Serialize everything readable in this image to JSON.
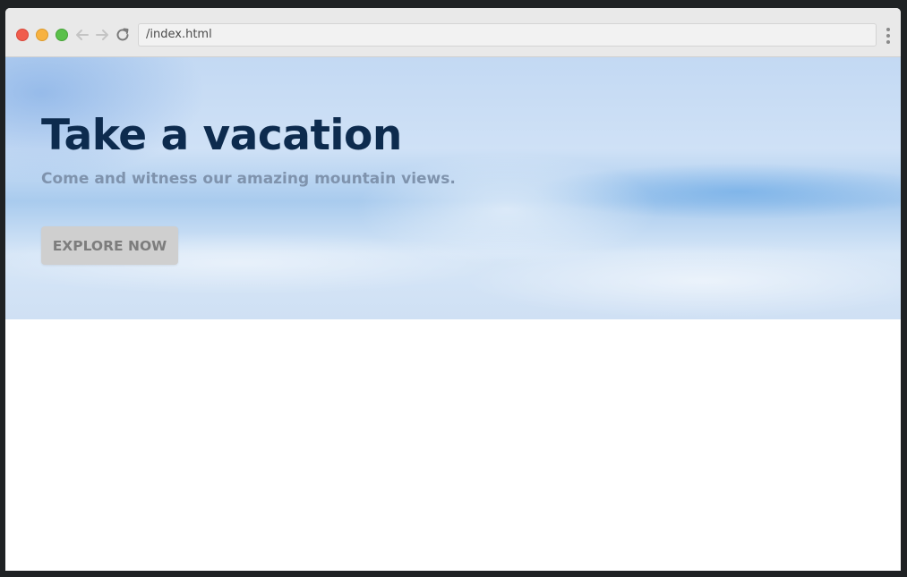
{
  "browser": {
    "url": "/index.html",
    "traffic_lights": [
      "close",
      "minimize",
      "zoom"
    ],
    "icons": {
      "back": "arrow-left-icon",
      "forward": "arrow-right-icon",
      "reload": "reload-icon",
      "menu": "kebab-menu-icon"
    }
  },
  "hero": {
    "title": "Take a vacation",
    "subtitle": "Come and witness our amazing mountain views.",
    "button_label": "EXPLORE NOW"
  },
  "colors": {
    "title": "#0d2b4e",
    "subtitle": "#7f93ad",
    "button_bg": "#cfcfcf",
    "button_text": "#7d7d7d",
    "sky": "#c3d9f3"
  }
}
